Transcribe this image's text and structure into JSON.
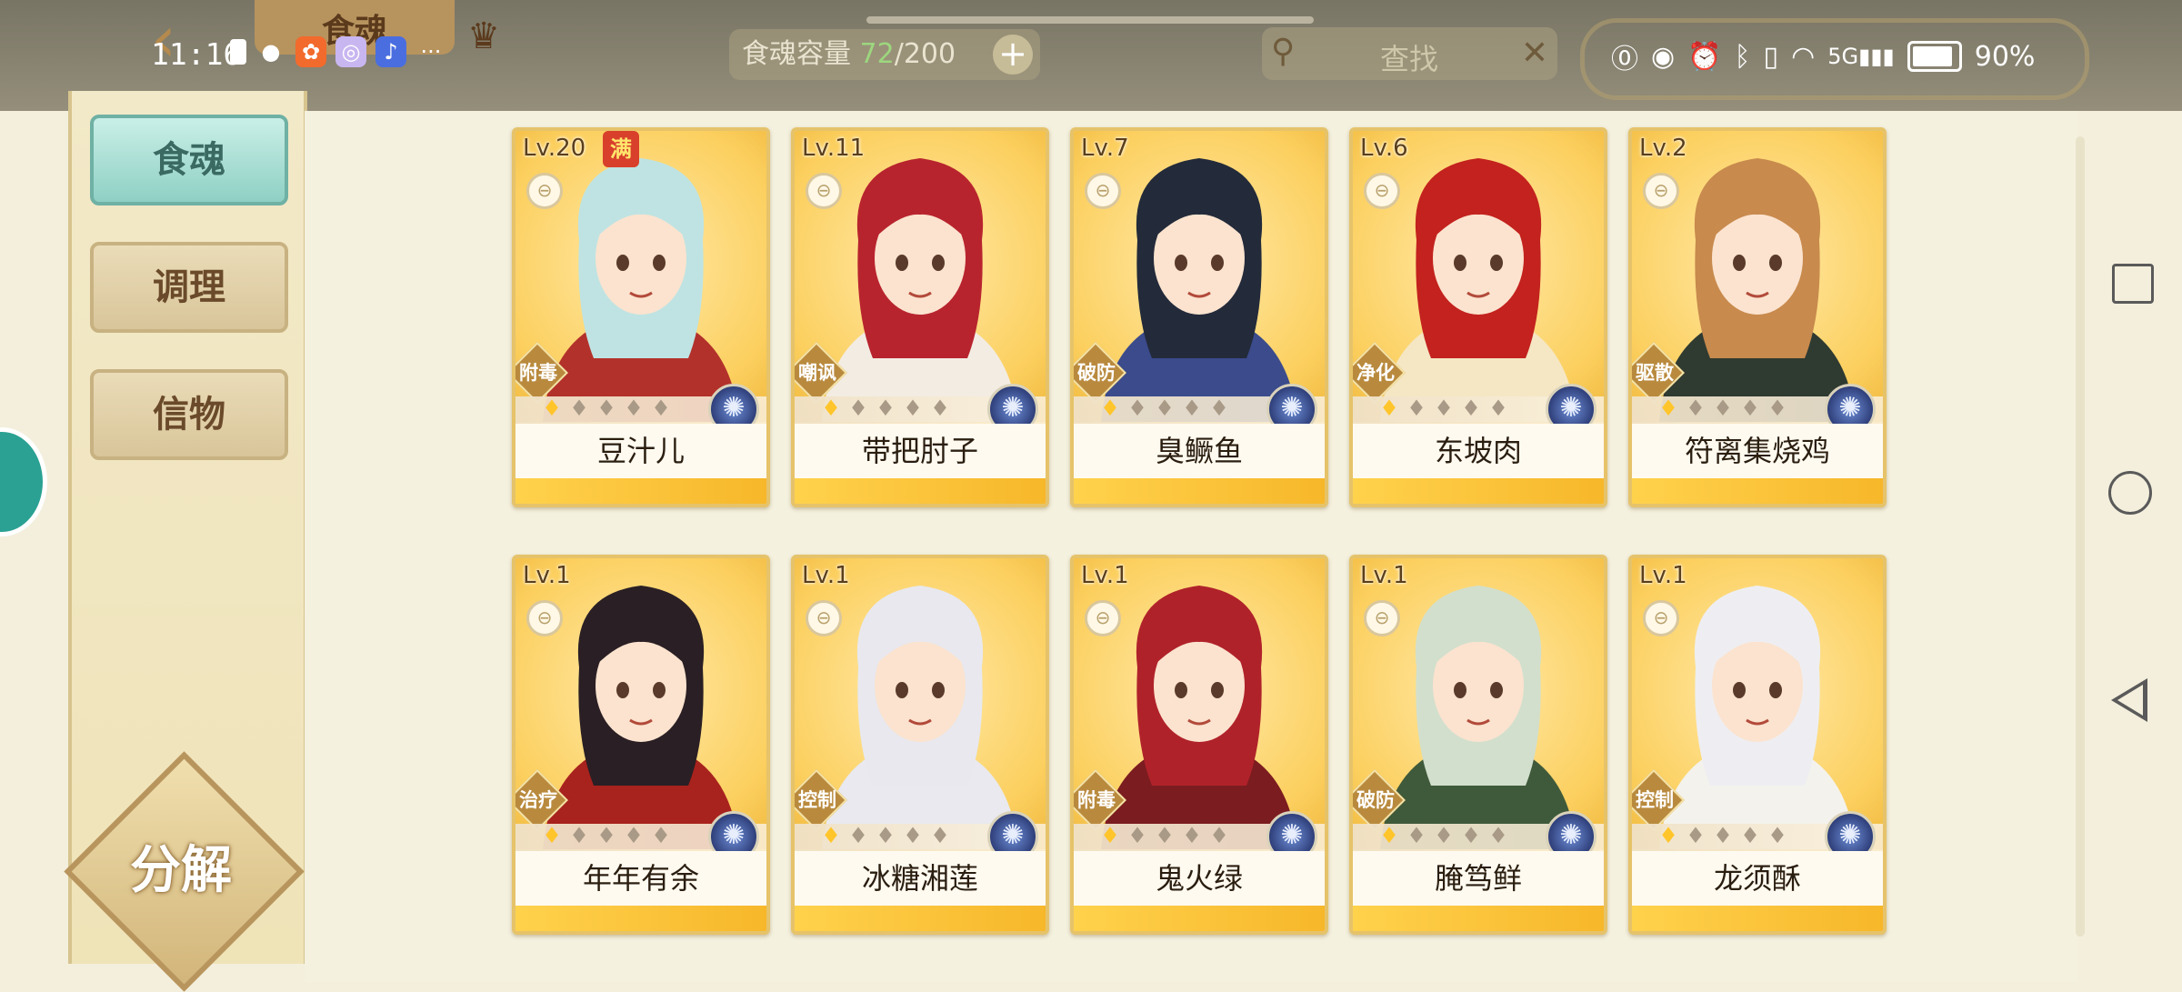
{
  "status_bar": {
    "time": "11:16",
    "left_icons": [
      "sim-icon",
      "qq-icon",
      "app-icon",
      "browser-icon",
      "music-icon"
    ],
    "more": "···",
    "battery": "90%",
    "battery_level": 0.9,
    "network": "5G"
  },
  "header": {
    "title": "食魂",
    "capacity_label": "食魂容量",
    "capacity_current": "72",
    "capacity_sep_max": "/200",
    "capacity_add": "+",
    "search_placeholder": "查找",
    "search_clear": "✕"
  },
  "sidebar": {
    "items": [
      {
        "label": "食魂",
        "active": true
      },
      {
        "label": "调理",
        "active": false
      },
      {
        "label": "信物",
        "active": false
      }
    ],
    "decompose_label": "分解"
  },
  "cards": [
    {
      "level": "Lv.20",
      "max_badge": "满",
      "role": "附毒",
      "name": "豆汁儿",
      "stars_lit": 1,
      "stars_total": 5,
      "hair": "#bfe3e2",
      "outfit": "#b3312b"
    },
    {
      "level": "Lv.11",
      "role": "嘲讽",
      "name": "带把肘子",
      "stars_lit": 1,
      "stars_total": 5,
      "hair": "#b8242e",
      "outfit": "#f3ece2"
    },
    {
      "level": "Lv.7",
      "role": "破防",
      "name": "臭鳜鱼",
      "stars_lit": 1,
      "stars_total": 5,
      "hair": "#232a3a",
      "outfit": "#3b4b8c"
    },
    {
      "level": "Lv.6",
      "role": "净化",
      "name": "东坡肉",
      "stars_lit": 1,
      "stars_total": 5,
      "hair": "#c3221e",
      "outfit": "#f5e7c4"
    },
    {
      "level": "Lv.2",
      "role": "驱散",
      "name": "符离集烧鸡",
      "stars_lit": 1,
      "stars_total": 5,
      "hair": "#c88a4d",
      "outfit": "#2f3a31"
    },
    {
      "level": "Lv.1",
      "role": "治疗",
      "name": "年年有余",
      "stars_lit": 1,
      "stars_total": 5,
      "hair": "#2a1f24",
      "outfit": "#a8221e"
    },
    {
      "level": "Lv.1",
      "role": "控制",
      "name": "冰糖湘莲",
      "stars_lit": 1,
      "stars_total": 5,
      "hair": "#e8e8ee",
      "outfit": "#e9e9ef"
    },
    {
      "level": "Lv.1",
      "role": "附毒",
      "name": "鬼火绿",
      "stars_lit": 1,
      "stars_total": 5,
      "hair": "#b0222a",
      "outfit": "#7b1c20"
    },
    {
      "level": "Lv.1",
      "role": "破防",
      "name": "腌笃鲜",
      "stars_lit": 1,
      "stars_total": 5,
      "hair": "#d2dfcd",
      "outfit": "#3f5a3a"
    },
    {
      "level": "Lv.1",
      "role": "控制",
      "name": "龙须酥",
      "stars_lit": 1,
      "stars_total": 5,
      "hair": "#eeeef2",
      "outfit": "#f4f2ec"
    }
  ],
  "colors": {
    "accent_teal": "#8fd0c4",
    "card_gold": "#ffd86b",
    "star_lit": "#ffc52a",
    "max_badge": "#d8402c"
  }
}
